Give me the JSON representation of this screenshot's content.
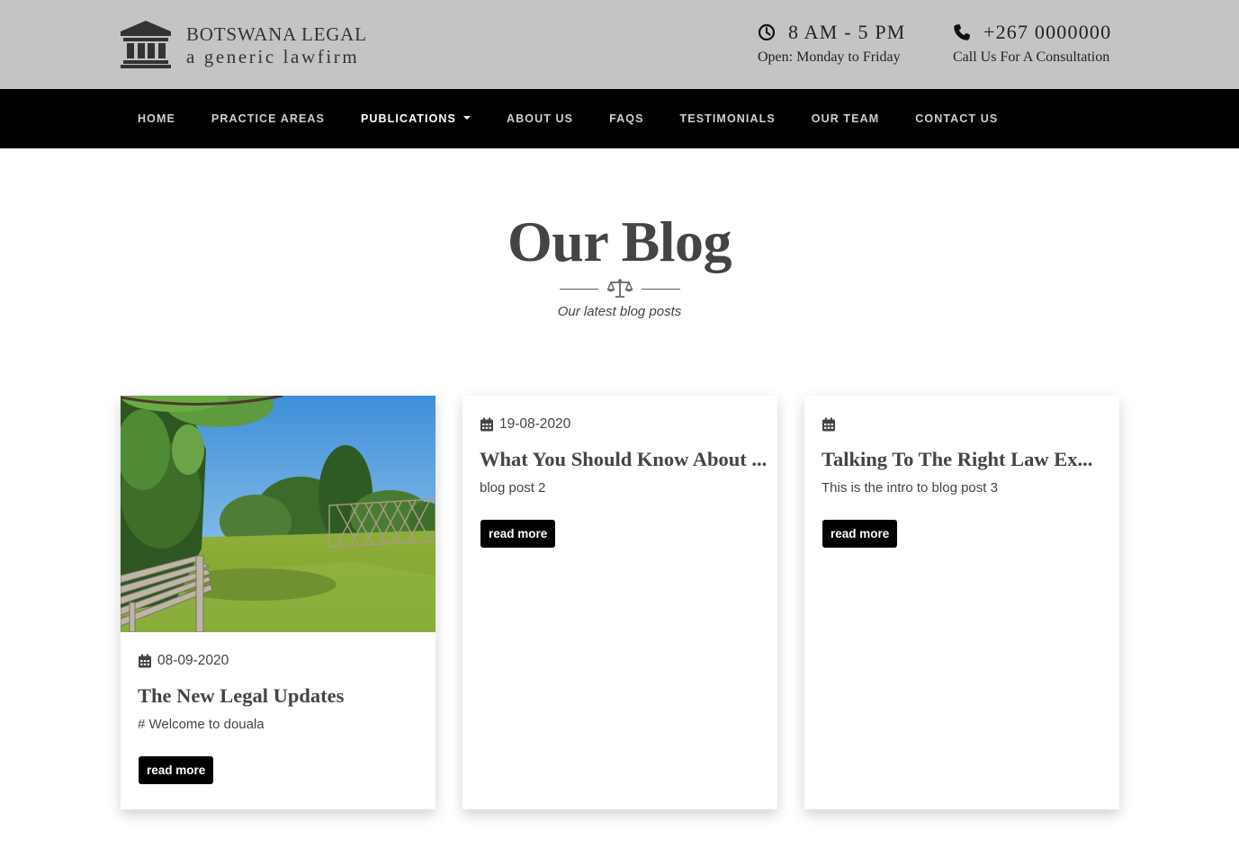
{
  "brand": {
    "line1": "BOTSWANA LEGAL",
    "line2": "a generic lawfirm",
    "icon": "courthouse-icon"
  },
  "contact": {
    "hours_main": "8 AM - 5 PM",
    "hours_sub": "Open: Monday to Friday",
    "phone_main": "+267 0000000",
    "phone_sub": "Call Us For A Consultation"
  },
  "nav": {
    "items": [
      {
        "label": "HOME"
      },
      {
        "label": "PRACTICE AREAS"
      },
      {
        "label": "PUBLICATIONS"
      },
      {
        "label": "ABOUT US"
      },
      {
        "label": "FAQS"
      },
      {
        "label": "TESTIMONIALS"
      },
      {
        "label": "OUR TEAM"
      },
      {
        "label": "CONTACT US"
      }
    ],
    "active": "PUBLICATIONS"
  },
  "section": {
    "title": "Our Blog",
    "subtitle": "Our latest blog posts"
  },
  "posts": [
    {
      "date": "08-09-2020",
      "title": "The New Legal Updates",
      "text": "# Welcome to douala",
      "button": "read more"
    },
    {
      "date": "19-08-2020",
      "title": "What You Should Know About ...",
      "text": "blog post 2",
      "button": "read more"
    },
    {
      "date": "",
      "title": "Talking To The Right Law Ex...",
      "text": "This is the intro to blog post 3",
      "button": "read more"
    }
  ],
  "colors": {
    "topbar": "#c4c4c4",
    "navbar": "#000000",
    "text": "#444444"
  }
}
